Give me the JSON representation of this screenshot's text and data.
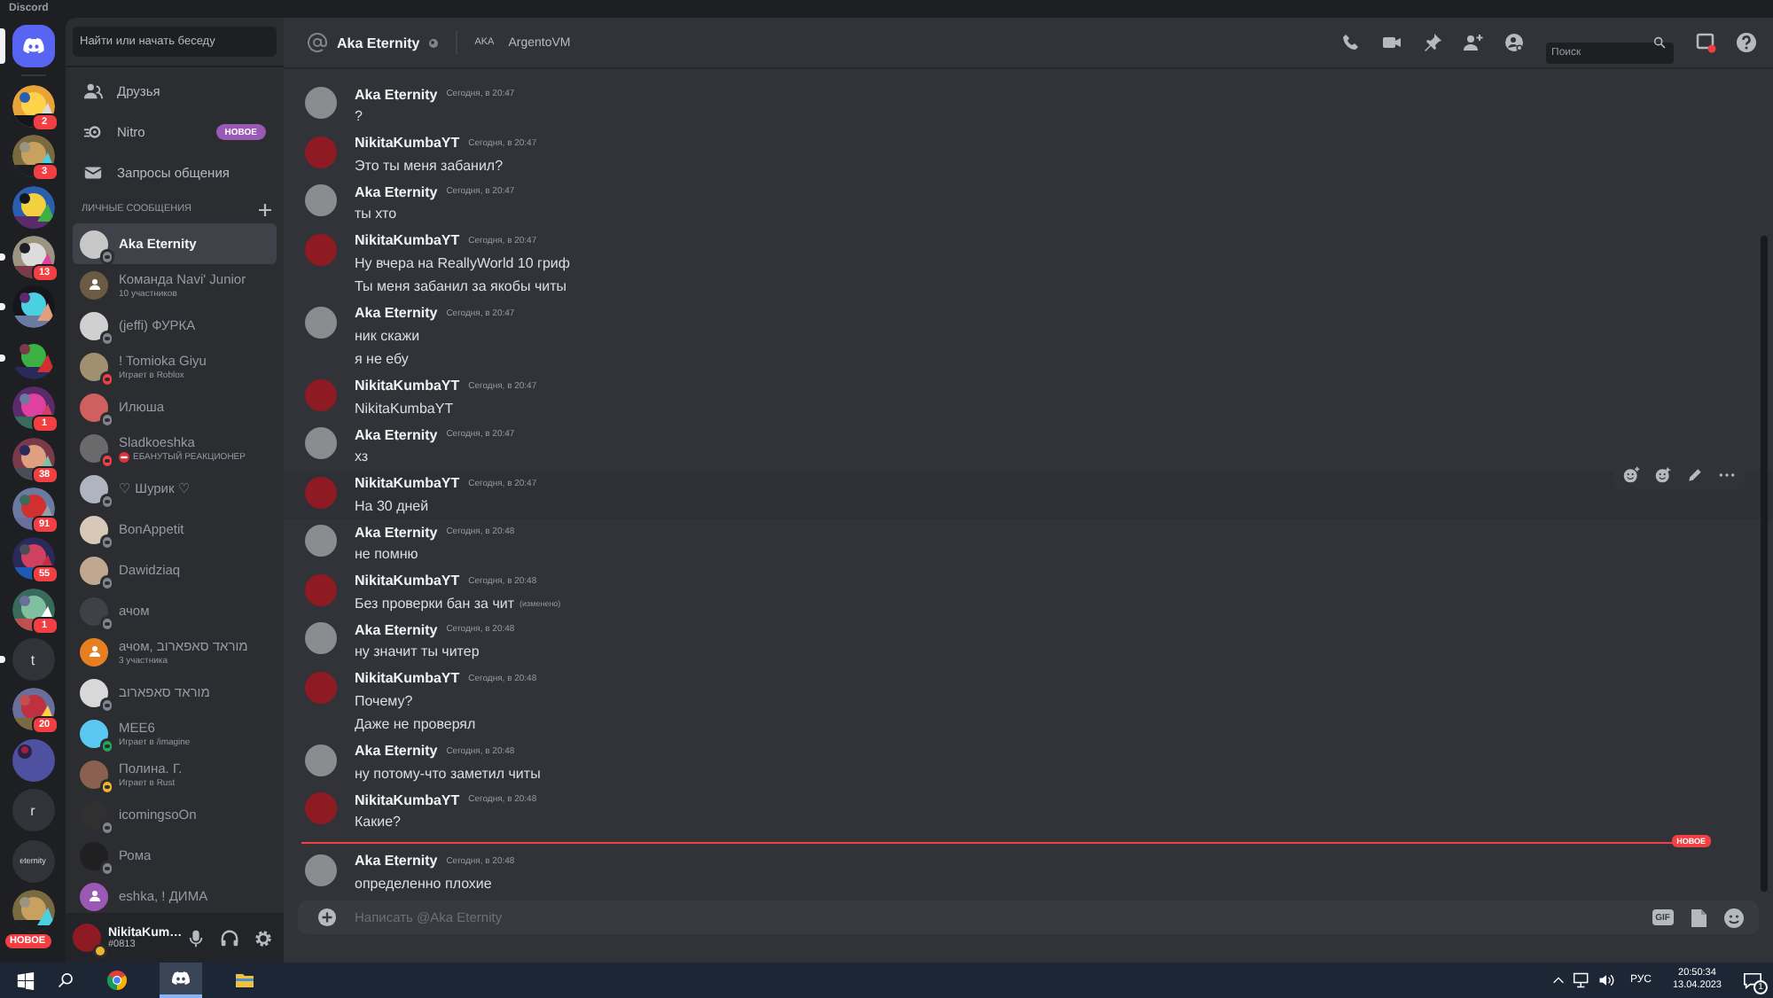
{
  "window": {
    "title": "Discord"
  },
  "servers": [
    {
      "kind": "home",
      "selected": true,
      "unread": false
    },
    {
      "kind": "picture",
      "badge": "2",
      "selected": false,
      "unread": false
    },
    {
      "kind": "picture",
      "badge": "3",
      "selected": false,
      "unread": false
    },
    {
      "kind": "picture",
      "selected": false,
      "unread": false
    },
    {
      "kind": "picture",
      "badge": "13",
      "selected": false,
      "unread": true
    },
    {
      "kind": "picture",
      "selected": false,
      "unread": true
    },
    {
      "kind": "picture",
      "selected": false,
      "unread": true
    },
    {
      "kind": "picture",
      "badge": "1",
      "selected": false,
      "unread": false
    },
    {
      "kind": "picture",
      "badge": "38",
      "selected": false,
      "unread": false
    },
    {
      "kind": "picture",
      "badge": "91",
      "selected": false,
      "unread": false
    },
    {
      "kind": "picture",
      "badge": "55",
      "selected": false,
      "unread": false
    },
    {
      "kind": "picture",
      "badge": "1",
      "selected": false,
      "unread": false
    },
    {
      "kind": "text",
      "label": "t",
      "selected": false,
      "unread": true
    },
    {
      "kind": "picture",
      "badge": "20",
      "selected": false,
      "unread": false
    },
    {
      "kind": "folder",
      "selected": false,
      "unread": false
    },
    {
      "kind": "text",
      "label": "r",
      "selected": false,
      "unread": false
    },
    {
      "kind": "text",
      "label": "eternity",
      "selected": false,
      "unread": false
    },
    {
      "kind": "picture",
      "badge": "НОВОЕ",
      "selected": false,
      "unread": false
    }
  ],
  "dm_search": {
    "placeholder": "Найти или начать беседу"
  },
  "nav": [
    {
      "kind": "friends",
      "label": "Друзья"
    },
    {
      "kind": "nitro",
      "label": "Nitro",
      "badge": "НОВОЕ"
    },
    {
      "kind": "requests",
      "label": "Запросы общения"
    }
  ],
  "dm_heading": "ЛИЧНЫЕ СООБЩЕНИЯ",
  "dms": [
    {
      "kind": "user",
      "name": "Aka Eternity",
      "status": {
        "color": "#80848e"
      },
      "selected": true
    },
    {
      "kind": "group",
      "name": "Команда Navi' Junior",
      "subtitle": "10 участников",
      "color": "#6b5b45",
      "selected": false
    },
    {
      "kind": "user",
      "name": "(jeffi) ФУРКА",
      "status": {
        "color": "#80848e"
      },
      "selected": false
    },
    {
      "kind": "user",
      "name": "! Tomioka Giyu",
      "subtitle": "Играет в Roblox",
      "status": {
        "color": "#f23f43"
      },
      "selected": false
    },
    {
      "kind": "user",
      "name": "Илюша",
      "status": {
        "color": "#80848e"
      },
      "selected": false
    },
    {
      "kind": "user",
      "name": "Sladkoeshka",
      "subtitle": "ЕБАНУТЫЙ РЕАКЦИОНЕР",
      "no_entry_icon": true,
      "status": {
        "color": "#f23f43"
      },
      "selected": false
    },
    {
      "kind": "user",
      "name": "♡ Шурик ♡",
      "status": {
        "color": "#80848e"
      },
      "selected": false
    },
    {
      "kind": "user",
      "name": "BonAppetit",
      "status": {
        "color": "#80848e"
      },
      "selected": false
    },
    {
      "kind": "user",
      "name": "Dawidziaq",
      "status": {
        "color": "#80848e"
      },
      "selected": false
    },
    {
      "kind": "user",
      "name": "ачом",
      "status": {
        "color": "#80848e"
      },
      "selected": false
    },
    {
      "kind": "group",
      "name": "ачом, מוראד סאפארוב",
      "subtitle": "3 участника",
      "color": "#e67e22",
      "selected": false
    },
    {
      "kind": "user",
      "name": "מוראד סאפארוב",
      "status": {
        "color": "#80848e"
      },
      "selected": false
    },
    {
      "kind": "user",
      "name": "MEE6",
      "subtitle": "Играет в /imagine",
      "status": {
        "color": "#23a55a"
      },
      "selected": false
    },
    {
      "kind": "user",
      "name": "Полина. Г.",
      "subtitle": "Играет в Rust",
      "status": {
        "color": "#f0b232"
      },
      "selected": false
    },
    {
      "kind": "user",
      "name": "icomingsoOn",
      "status": {
        "color": "#80848e"
      },
      "selected": false
    },
    {
      "kind": "user",
      "name": "Рома",
      "status": {
        "color": "#80848e"
      },
      "selected": false
    },
    {
      "kind": "group",
      "name": "eshka, ! ДИМА",
      "color": "#9b59b6",
      "selected": false
    }
  ],
  "user_panel": {
    "name": "NikitaKum…",
    "tag": "#0813",
    "status": {
      "color": "#f0b232"
    }
  },
  "chat_header": {
    "title": "Aka Eternity",
    "status": {
      "color": "#80848e"
    },
    "tag": "AKA",
    "subtitle": "ArgentoVM",
    "search_placeholder": "Поиск"
  },
  "messages": [
    {
      "avatar": {
        "color": "#8a8c90"
      },
      "author": "Aka Eternity",
      "time": "Сегодня, в 20:47",
      "lines": [
        {
          "text": "?"
        }
      ],
      "hovered": false
    },
    {
      "avatar": {
        "color": "#8e1a24"
      },
      "author": "NikitaKumbaYT",
      "time": "Сегодня, в 20:47",
      "lines": [
        {
          "text": "Это ты меня забанил?"
        }
      ],
      "hovered": false
    },
    {
      "avatar": {
        "color": "#8a8c90"
      },
      "author": "Aka Eternity",
      "time": "Сегодня, в 20:47",
      "lines": [
        {
          "text": "ты хто"
        }
      ],
      "hovered": false
    },
    {
      "avatar": {
        "color": "#8e1a24"
      },
      "author": "NikitaKumbaYT",
      "time": "Сегодня, в 20:47",
      "lines": [
        {
          "text": "Ну вчера на ReallyWorld 10 гриф"
        },
        {
          "text": "Ты меня забанил за якобы читы"
        }
      ],
      "hovered": false
    },
    {
      "avatar": {
        "color": "#8a8c90"
      },
      "author": "Aka Eternity",
      "time": "Сегодня, в 20:47",
      "lines": [
        {
          "text": "ник скажи"
        },
        {
          "text": "я не ебу"
        }
      ],
      "hovered": false
    },
    {
      "avatar": {
        "color": "#8e1a24"
      },
      "author": "NikitaKumbaYT",
      "time": "Сегодня, в 20:47",
      "lines": [
        {
          "text": "NikitaKumbaYT"
        }
      ],
      "hovered": false
    },
    {
      "avatar": {
        "color": "#8a8c90"
      },
      "author": "Aka Eternity",
      "time": "Сегодня, в 20:47",
      "lines": [
        {
          "text": "хз"
        }
      ],
      "hovered": false
    },
    {
      "avatar": {
        "color": "#8e1a24"
      },
      "author": "NikitaKumbaYT",
      "time": "Сегодня, в 20:47",
      "lines": [
        {
          "text": "На 30 дней"
        }
      ],
      "hovered": true
    },
    {
      "avatar": {
        "color": "#8a8c90"
      },
      "author": "Aka Eternity",
      "time": "Сегодня, в 20:48",
      "lines": [
        {
          "text": "не помню"
        }
      ],
      "hovered": false
    },
    {
      "avatar": {
        "color": "#8e1a24"
      },
      "author": "NikitaKumbaYT",
      "time": "Сегодня, в 20:48",
      "lines": [
        {
          "text": "Без проверки бан за чит",
          "tag": "(изменено)"
        }
      ],
      "hovered": false
    },
    {
      "avatar": {
        "color": "#8a8c90"
      },
      "author": "Aka Eternity",
      "time": "Сегодня, в 20:48",
      "lines": [
        {
          "text": "ну значит ты читер"
        }
      ],
      "hovered": false
    },
    {
      "avatar": {
        "color": "#8e1a24"
      },
      "author": "NikitaKumbaYT",
      "time": "Сегодня, в 20:48",
      "lines": [
        {
          "text": "Почему?"
        },
        {
          "text": "Даже не проверял"
        }
      ],
      "hovered": false
    },
    {
      "avatar": {
        "color": "#8a8c90"
      },
      "author": "Aka Eternity",
      "time": "Сегодня, в 20:48",
      "lines": [
        {
          "text": "ну потому-что заметил читы"
        }
      ],
      "hovered": false
    },
    {
      "avatar": {
        "color": "#8e1a24"
      },
      "author": "NikitaKumbaYT",
      "time": "Сегодня, в 20:48",
      "lines": [
        {
          "text": "Какие?"
        }
      ],
      "hovered": false
    },
    {
      "avatar": {
        "color": "#8a8c90"
      },
      "author": "Aka Eternity",
      "time": "Сегодня, в 20:48",
      "lines": [
        {
          "text": "определенно плохие"
        }
      ],
      "hovered": false,
      "divider_label": "НОВОЕ"
    }
  ],
  "composer": {
    "placeholder": "Написать @Aka Eternity",
    "gif_label": "GIF"
  },
  "taskbar": {
    "apps": [
      {
        "kind": "chrome",
        "active": false
      },
      {
        "kind": "discord",
        "active": true
      },
      {
        "kind": "explorer",
        "active": false
      }
    ],
    "language": "РУС",
    "time": "20:50:34",
    "date": "13.04.2023",
    "notifications": "1"
  }
}
